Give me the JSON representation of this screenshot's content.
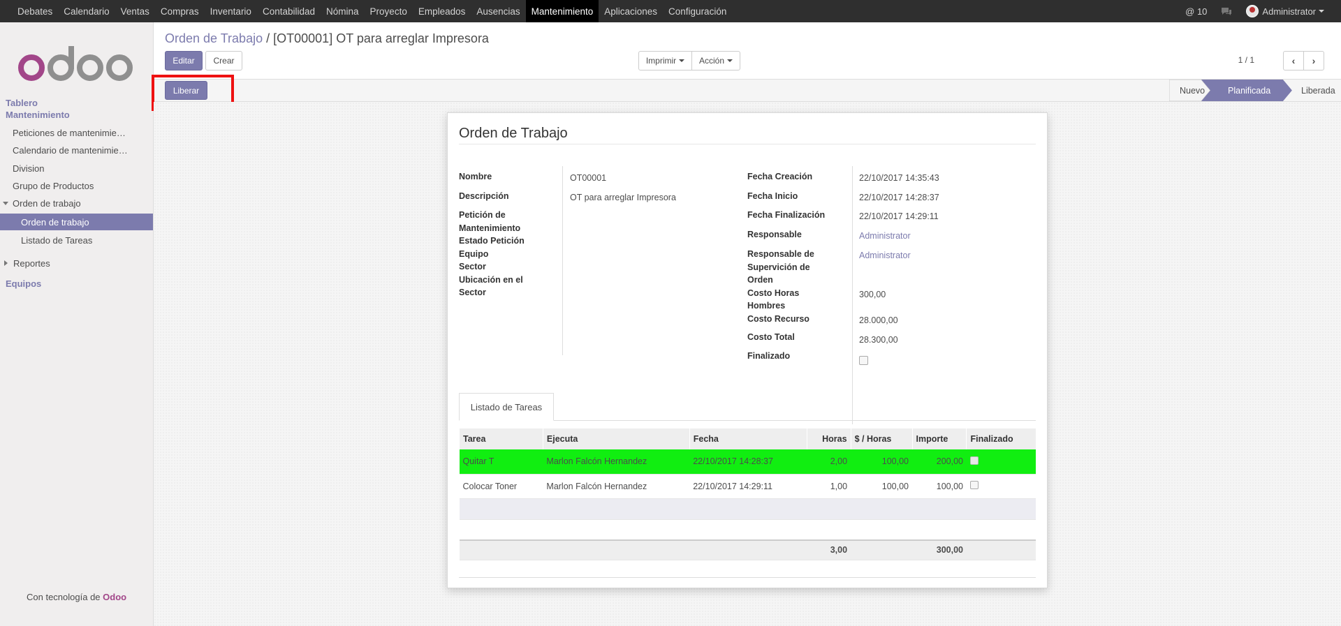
{
  "topnav": {
    "items": [
      "Debates",
      "Calendario",
      "Ventas",
      "Compras",
      "Inventario",
      "Contabilidad",
      "Nómina",
      "Proyecto",
      "Empleados",
      "Ausencias",
      "Mantenimiento",
      "Aplicaciones",
      "Configuración"
    ],
    "active": "Mantenimiento",
    "notifications": "@ 10",
    "user": "Administrator"
  },
  "sidebar": {
    "section_title_1": "Tablero",
    "section_title_2": "Mantenimiento",
    "items": [
      "Peticiones de mantenimie…",
      "Calendario de mantenimie…",
      "Division",
      "Grupo de Productos",
      "Orden de trabajo",
      "Orden de trabajo",
      "Listado de Tareas",
      "Reportes"
    ],
    "equipos": "Equipos",
    "powered_prefix": "Con tecnología de",
    "powered_brand": "Odoo"
  },
  "breadcrumb": {
    "parent": "Orden de Trabajo",
    "separator": "/",
    "current": "[OT00001] OT para arreglar Impresora"
  },
  "buttons": {
    "edit": "Editar",
    "create": "Crear",
    "print": "Imprimir",
    "action": "Acción",
    "release": "Liberar"
  },
  "pager": {
    "value": "1 / 1"
  },
  "statusbar": {
    "stages": [
      "Nuevo",
      "Planificada",
      "Liberada"
    ],
    "current": "Planificada"
  },
  "form": {
    "title": "Orden de Trabajo",
    "left_labels": {
      "nombre": "Nombre",
      "descripcion": "Descripción",
      "peticion_1": "Petición de",
      "peticion_2": "Mantenimiento",
      "estado": "Estado Petición",
      "equipo": "Equipo",
      "sector": "Sector",
      "ubicacion_1": "Ubicación en el",
      "ubicacion_2": "Sector"
    },
    "left_values": {
      "nombre": "OT00001",
      "descripcion": "OT para arreglar Impresora"
    },
    "right_labels": {
      "fecha_creacion": "Fecha Creación",
      "fecha_inicio": "Fecha Inicio",
      "fecha_fin": "Fecha Finalización",
      "responsable": "Responsable",
      "resp_sup_1": "Responsable de",
      "resp_sup_2": "Supervición de",
      "resp_sup_3": "Orden",
      "costo_hh_1": "Costo Horas",
      "costo_hh_2": "Hombres",
      "costo_recurso": "Costo Recurso",
      "costo_total": "Costo Total",
      "finalizado": "Finalizado"
    },
    "right_values": {
      "fecha_creacion": "22/10/2017 14:35:43",
      "fecha_inicio": "22/10/2017 14:28:37",
      "fecha_fin": "22/10/2017 14:29:11",
      "responsable": "Administrator",
      "resp_sup": "Administrator",
      "costo_hh": "300,00",
      "costo_recurso": "28.000,00",
      "costo_total": "28.300,00"
    }
  },
  "tab": {
    "label": "Listado de Tareas"
  },
  "tasks": {
    "headers": [
      "Tarea",
      "Ejecuta",
      "Fecha",
      "Horas",
      "$ / Horas",
      "Importe",
      "Finalizado"
    ],
    "rows": [
      {
        "tarea": "Quitar T",
        "ejecuta": "Marlon Falcón Hernandez",
        "fecha": "22/10/2017 14:28:37",
        "horas": "2,00",
        "precio": "100,00",
        "importe": "200,00"
      },
      {
        "tarea": "Colocar Toner",
        "ejecuta": "Marlon Falcón Hernandez",
        "fecha": "22/10/2017 14:29:11",
        "horas": "1,00",
        "precio": "100,00",
        "importe": "100,00"
      }
    ],
    "totals": {
      "horas": "3,00",
      "importe": "300,00"
    }
  },
  "colors": {
    "accent": "#7c7bad",
    "highlight_row": "#11ee11",
    "annotation": "#ee1111"
  }
}
